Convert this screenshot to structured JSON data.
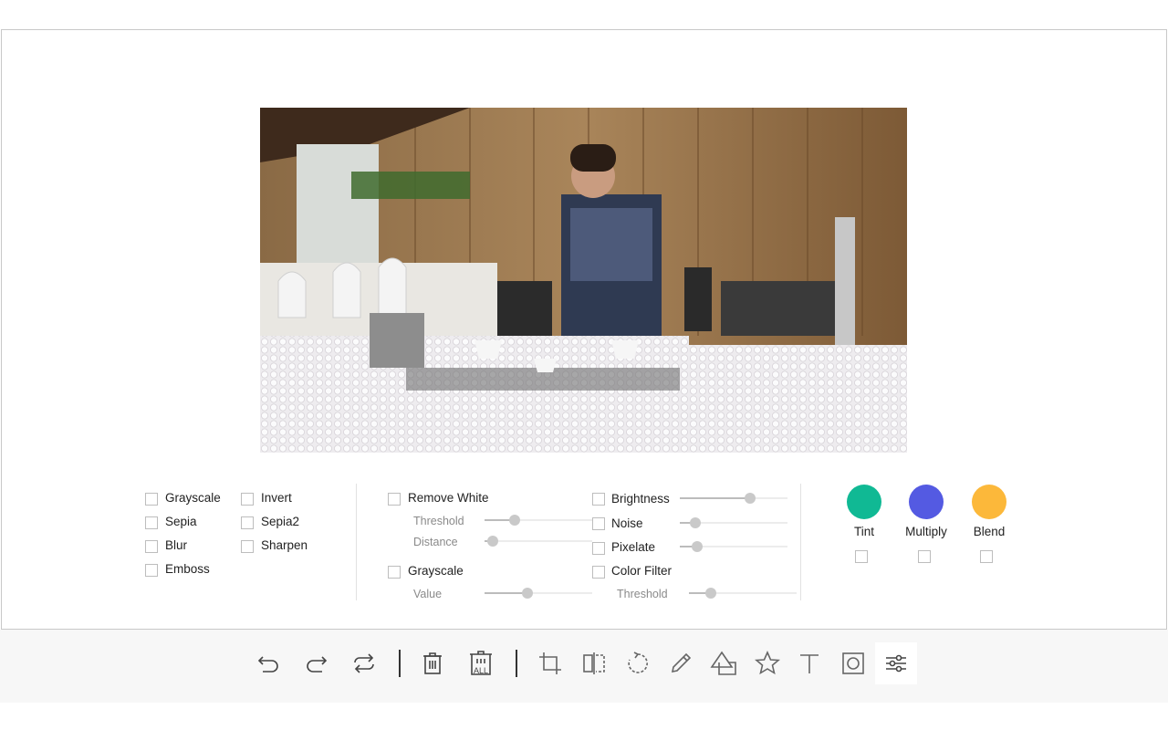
{
  "filters_basic": [
    {
      "label": "Grayscale",
      "checked": false
    },
    {
      "label": "Invert",
      "checked": false
    },
    {
      "label": "Sepia",
      "checked": false
    },
    {
      "label": "Sepia2",
      "checked": false
    },
    {
      "label": "Blur",
      "checked": false
    },
    {
      "label": "Sharpen",
      "checked": false
    },
    {
      "label": "Emboss",
      "checked": false
    }
  ],
  "remove_white": {
    "label": "Remove White",
    "checked": false,
    "threshold": {
      "label": "Threshold",
      "value": 0.28
    },
    "distance": {
      "label": "Distance",
      "value": 0.08
    }
  },
  "grayscale2": {
    "label": "Grayscale",
    "checked": false,
    "value": {
      "label": "Value",
      "value": 0.4
    }
  },
  "adjustments": {
    "brightness": {
      "label": "Brightness",
      "checked": false,
      "value": 0.65
    },
    "noise": {
      "label": "Noise",
      "checked": false,
      "value": 0.14
    },
    "pixelate": {
      "label": "Pixelate",
      "checked": false,
      "value": 0.16
    },
    "color_filter": {
      "label": "Color Filter",
      "checked": false,
      "threshold": {
        "label": "Threshold",
        "value": 0.2
      }
    }
  },
  "color_blends": [
    {
      "label": "Tint",
      "color": "#10b994",
      "checked": false
    },
    {
      "label": "Multiply",
      "color": "#545ae2",
      "checked": false
    },
    {
      "label": "Blend",
      "color": "#fcb83a",
      "checked": false
    }
  ],
  "toolbar": {
    "tools": [
      {
        "name": "undo",
        "icon": "undo-icon"
      },
      {
        "name": "redo",
        "icon": "redo-icon"
      },
      {
        "name": "reset",
        "icon": "reset-icon"
      },
      {
        "name": "delete",
        "icon": "delete-icon"
      },
      {
        "name": "delete-all",
        "icon": "delete-all-icon",
        "text": "ALL"
      },
      {
        "name": "crop",
        "icon": "crop-icon"
      },
      {
        "name": "flip",
        "icon": "flip-icon"
      },
      {
        "name": "rotate",
        "icon": "rotate-icon"
      },
      {
        "name": "draw",
        "icon": "pencil-icon"
      },
      {
        "name": "shape",
        "icon": "shape-icon"
      },
      {
        "name": "icon",
        "icon": "star-icon"
      },
      {
        "name": "text",
        "icon": "text-icon"
      },
      {
        "name": "mask",
        "icon": "mask-icon"
      },
      {
        "name": "filter",
        "icon": "filter-icon",
        "active": true
      }
    ]
  }
}
